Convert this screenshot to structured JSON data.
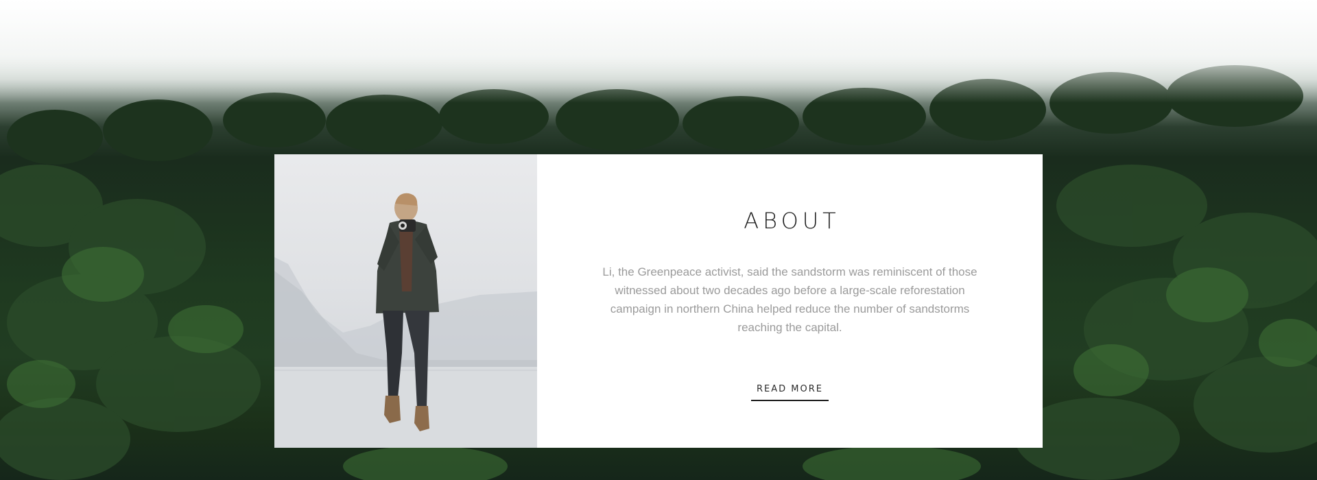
{
  "about": {
    "title": "ABOUT",
    "body": "Li, the Greenpeace activist, said the sandstorm was reminiscent of those witnessed about two decades ago before a large-scale reforestation campaign in northern China helped reduce the number of sandstorms reaching the capital.",
    "read_more_label": "READ MORE"
  },
  "colors": {
    "card_background": "#ffffff",
    "title": "#1c1c1c",
    "body_text": "#9a9a9a",
    "forest_dark": "#1a2c1d",
    "forest_green": "#2f5a2c"
  },
  "icons": {
    "background": "misty-forest-image",
    "photo": "man-with-camera-jumping-photo"
  }
}
